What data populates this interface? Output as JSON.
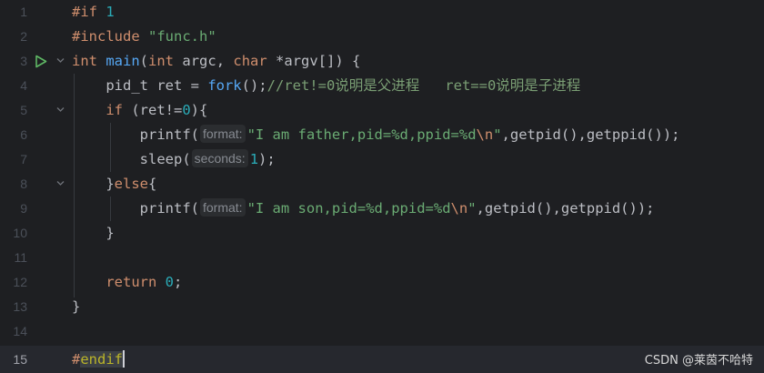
{
  "editor": {
    "line_numbers": [
      "1",
      "2",
      "3",
      "4",
      "5",
      "6",
      "7",
      "8",
      "9",
      "10",
      "11",
      "12",
      "13",
      "14",
      "15"
    ],
    "line1": {
      "kw": "#if",
      "num": "1"
    },
    "line2": {
      "kw": "#include",
      "str": "\"func.h\""
    },
    "line3": {
      "t1": "int",
      "t2": "main",
      "t3": "(",
      "t4": "int",
      "t5": "argc",
      "t6": ", ",
      "t7": "char",
      "t8": " *",
      "t9": "argv",
      "t10": "[]) {"
    },
    "line4": {
      "code": "pid_t ret = ",
      "fn": "fork",
      "rest": "();",
      "comment": "//ret!=0说明是父进程   ret==0说明是子进程"
    },
    "line5": {
      "kw": "if",
      "a": " (ret!=",
      "num": "0",
      "b": "){"
    },
    "line6": {
      "fn": "printf(",
      "hint": "format:",
      "str1": "\"I am father,pid=%d,ppid=%d",
      "esc": "\\n",
      "str2": "\"",
      "rest": ",getpid(),getppid());"
    },
    "line7": {
      "fn": "sleep(",
      "hint": "seconds:",
      "num": "1",
      "rest": ");"
    },
    "line8": {
      "a": "}",
      "kw": "else",
      "b": "{"
    },
    "line9": {
      "fn": "printf(",
      "hint": "format:",
      "str1": "\"I am son,pid=%d,ppid=%d",
      "esc": "\\n",
      "str2": "\"",
      "rest": ",getpid(),getppid());"
    },
    "line10": {
      "code": "}"
    },
    "line12": {
      "kw": "return",
      "num": "0",
      "rest": ";"
    },
    "line13": {
      "code": "}"
    },
    "line15": {
      "kw1": "#",
      "kw2": "endif"
    }
  },
  "watermark": "CSDN @莱茵不哈特",
  "colors": {
    "background": "#1e1f22",
    "keyword": "#cf8e6d",
    "number": "#2aacb8",
    "string": "#6aab73",
    "comment": "#7a9e74",
    "run_icon": "#5fb865"
  },
  "icons": {
    "run": "run-gutter-icon",
    "fold": "fold-chevron-icon"
  }
}
